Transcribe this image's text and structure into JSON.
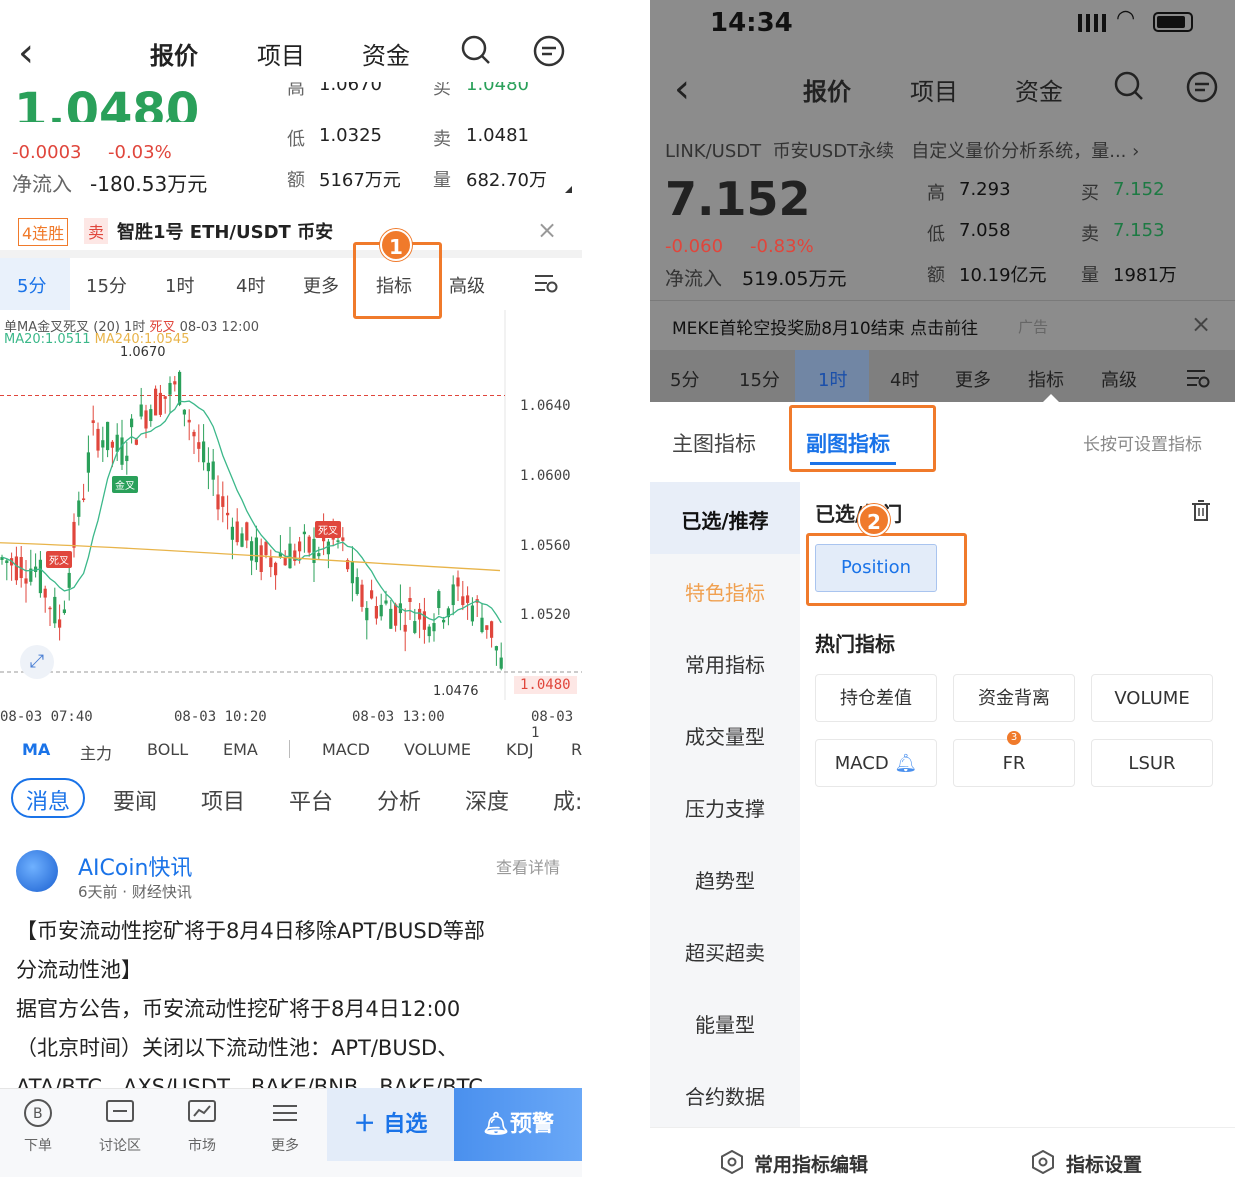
{
  "left": {
    "header": {
      "back": "‹",
      "tabs": [
        "报价",
        "项目",
        "资金"
      ]
    },
    "price": {
      "main": "1.0480",
      "arrow": "↗",
      "change": "-0.0003",
      "change_pct": "-0.03%",
      "net_inflow_label": "净流入",
      "net_inflow": "-180.53万元",
      "high_label": "高",
      "high": "1.0670",
      "low_label": "低",
      "low": "1.0325",
      "amount_label": "额",
      "amount": "5167万元",
      "buy_label": "买",
      "buy": "1.0480",
      "sell_label": "卖",
      "sell": "1.0481",
      "vol_label": "量",
      "vol": "682.70万"
    },
    "signal": {
      "streak": "4连胜",
      "side": "卖",
      "text": "智胜1号 ETH/USDT 币安"
    },
    "timeframes": [
      "5分",
      "15分",
      "1时",
      "4时",
      "更多",
      "指标",
      "高级"
    ],
    "chart": {
      "legend1": "单MA金叉死叉 (20) 1时",
      "legend1_b": "死叉",
      "legend1_c": "08-03 12:00",
      "ma20": "MA20:1.0511",
      "ma240": "MA240:1.0545",
      "high_label": "1.0670",
      "low_label": "1.0476",
      "ticks": [
        "1.0640",
        "1.0600",
        "1.0560",
        "1.0520",
        "1.0480"
      ],
      "dates": [
        "08-03 07:40",
        "08-03 10:20",
        "08-03 13:00",
        "08-03 1"
      ],
      "tag_gold": "金叉",
      "tag_dead": "死叉",
      "tag_dead2": "死叉"
    },
    "indicators": [
      "MA",
      "主力",
      "BOLL",
      "EMA",
      "MACD",
      "VOLUME",
      "KDJ",
      "R"
    ],
    "news_tabs": [
      "消息",
      "要闻",
      "项目",
      "平台",
      "分析",
      "深度",
      "成:"
    ],
    "news": {
      "source": "AICoin快讯",
      "meta": "6天前 · 财经快讯",
      "detail": "查看详情",
      "lines": [
        "【币安流动性挖矿将于8月4日移除APT/BUSD等部",
        "分流动性池】",
        "据官方公告，币安流动性挖矿将于8月4日12:00",
        "（北京时间）关闭以下流动性池：APT/BUSD、",
        "ATA/BTC、AXS/USDT、BAKE/BNB、BAKE/BTC"
      ]
    },
    "bottom": {
      "items": [
        "下单",
        "讨论区",
        "市场",
        "更多"
      ],
      "add": "自选",
      "alert": "预警"
    },
    "badge": "1"
  },
  "right": {
    "status": {
      "time": "14:34"
    },
    "header": {
      "back": "‹",
      "tabs": [
        "报价",
        "项目",
        "资金"
      ]
    },
    "pair": {
      "name": "LINK/USDT",
      "exchange": "币安USDT永续",
      "ad": "自定义量价分析系统，量...",
      "price": "7.152",
      "change": "-0.060",
      "change_pct": "-0.83%",
      "net_inflow_label": "净流入",
      "net_inflow": "519.05万元",
      "high_label": "高",
      "high": "7.293",
      "low_label": "低",
      "low": "7.058",
      "amount_label": "额",
      "amount": "10.19亿元",
      "buy_label": "买",
      "buy": "7.152",
      "sell_label": "卖",
      "sell": "7.153",
      "vol_label": "量",
      "vol": "1981万"
    },
    "banner": {
      "text": "MEKE首轮空投奖励8月10结束 点击前往",
      "ad": "广告"
    },
    "timeframes": [
      "5分",
      "15分",
      "1时",
      "4时",
      "更多",
      "指标",
      "高级"
    ],
    "panel": {
      "tab_main": "主图指标",
      "tab_sub": "副图指标",
      "hint": "长按可设置指标",
      "categories": [
        "已选/推荐",
        "特色指标",
        "常用指标",
        "成交量型",
        "压力支撑",
        "趋势型",
        "超买超卖",
        "能量型",
        "合约数据"
      ],
      "selected_title": "已选/热门",
      "selected_chip": "Position",
      "hot_title": "热门指标",
      "hot": [
        "持仓差值",
        "资金背离",
        "VOLUME",
        "MACD",
        "FR",
        "LSUR"
      ],
      "fr_badge": "3",
      "footer_left": "常用指标编辑",
      "footer_right": "指标设置"
    },
    "badge": "2"
  },
  "colors": {
    "accent": "#1a73e8",
    "orange": "#f07a2b",
    "red": "#e0463c",
    "green": "#2aa05a"
  }
}
